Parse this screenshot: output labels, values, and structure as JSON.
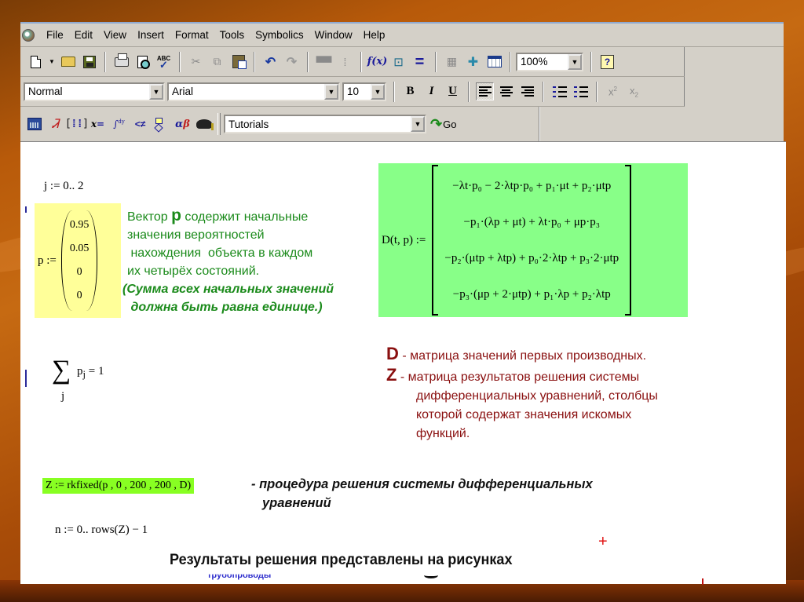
{
  "menu": [
    "File",
    "Edit",
    "View",
    "Insert",
    "Format",
    "Tools",
    "Symbolics",
    "Window",
    "Help"
  ],
  "toolbar_standard": {
    "buttons": [
      "new-document",
      "new-dropdown",
      "open",
      "save",
      "print",
      "print-preview",
      "spell-check",
      "cut",
      "copy",
      "paste",
      "undo",
      "redo",
      "align-across",
      "align-down",
      "insert-function",
      "insert-unit",
      "calculate",
      "insert-component",
      "resource-center",
      "insert-table",
      "help"
    ],
    "zoom_value": "100%"
  },
  "toolbar_formatting": {
    "style_value": "Normal",
    "font_value": "Arial",
    "size_value": "10",
    "bold": "B",
    "italic": "I",
    "underline": "U",
    "superscript_base": "x",
    "superscript_exp": "2",
    "subscript_base": "x",
    "subscript_sub": "2"
  },
  "toolbar_math": {
    "buttons": [
      "calculator",
      "graph",
      "matrix",
      "evaluation",
      "calculus",
      "boolean",
      "programming",
      "greek",
      "symbolic"
    ],
    "resources_value": "Tutorials",
    "go_label": "Go"
  },
  "worksheet": {
    "range_j": "j := 0.. 2",
    "vector_p": {
      "label": "p :=",
      "values": [
        "0.95",
        "0.05",
        "0",
        "0"
      ]
    },
    "vector_note": {
      "line1_prefix": "Вектор ",
      "line1_bold": "p",
      "line1_suffix": " содержит начальные",
      "line2": "значения  вероятностей",
      "line3": " нахождения  объекта в каждом",
      "line4": "их четырёх состояний.",
      "line5": "(Сумма всех начальных значений",
      "line6": " должна быть равна единице.)"
    },
    "matrix_D": {
      "label": "D(t, p) :=",
      "rows": [
        "−λt·p₀ − 2·λtp·p₀ + p₁·μt + p₂·μtp",
        "−p₁·(λp + μt) + λt·p₀ + μp·p₃",
        "−p₂·(μtp + λtp) + p₀·2·λtp + p₃·2·μtp",
        "−p₃·(μp + 2·μtp) + p₁·λp + p₂·λtp"
      ]
    },
    "sum_eq": {
      "sigma": "∑",
      "index": "j",
      "term": "p",
      "sub": "j",
      "rhs": " = 1"
    },
    "definitions": {
      "d_letter": "D",
      "d_text": " - матрица значений первых производных.",
      "z_letter": "Z",
      "z_text": " - матрица результатов решения системы",
      "z_line2": "дифференциальных уравнений, столбцы",
      "z_line3": "которой содержат значения искомых",
      "z_line4": "функций."
    },
    "rkfixed": "Z := rkfixed(p , 0 , 200 , 200 , D)",
    "rkfixed_note_line1": "- процедура решения системы дифференциальных",
    "rkfixed_note_line2": "уравнений",
    "range_n": "n := 0.. rows(Z) − 1",
    "caption": "Результаты решения представлены на рисунках",
    "blue_fragment": "трубопроводы",
    "red_plus": "+"
  }
}
